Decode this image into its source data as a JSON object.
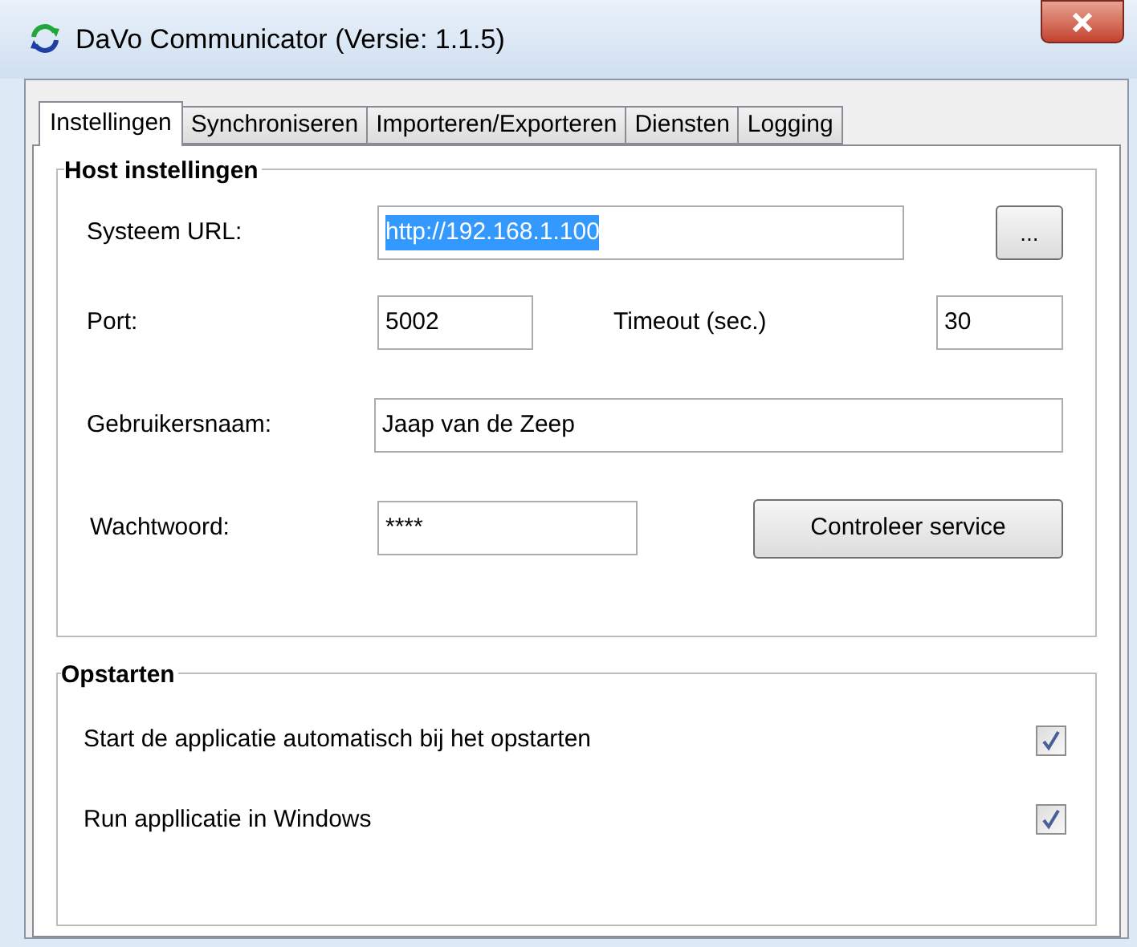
{
  "window": {
    "title": "DaVo Communicator (Versie: 1.1.5)"
  },
  "tabs": [
    {
      "label": "Instellingen",
      "selected": true
    },
    {
      "label": "Synchroniseren",
      "selected": false
    },
    {
      "label": "Importeren/Exporteren",
      "selected": false
    },
    {
      "label": "Diensten",
      "selected": false
    },
    {
      "label": "Logging",
      "selected": false
    }
  ],
  "host_settings": {
    "title": "Host instellingen",
    "url_label": "Systeem URL:",
    "url_value": "http://192.168.1.100",
    "url_selected": true,
    "browse_button": "...",
    "port_label": "Port:",
    "port_value": "5002",
    "timeout_label": "Timeout (sec.)",
    "timeout_value": "30",
    "username_label": "Gebruikersnaam:",
    "username_value": "Jaap van de Zeep",
    "password_label": "Wachtwoord:",
    "password_value": "****",
    "check_button": "Controleer service"
  },
  "startup": {
    "title": "Opstarten",
    "options": [
      {
        "label": "Start de applicatie automatisch bij het opstarten",
        "checked": true
      },
      {
        "label": "Run appllicatie in Windows",
        "checked": true
      }
    ]
  }
}
